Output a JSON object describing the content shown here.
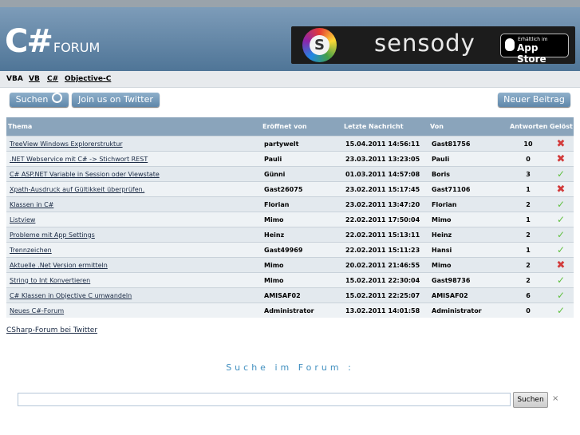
{
  "header": {
    "logo_big": "C#",
    "logo_small": "FORUM",
    "banner": {
      "brand": "sensody",
      "s_letter": "S",
      "appstore_small": "Erhältlich im",
      "appstore_big": "App Store"
    }
  },
  "languages": [
    "VBA",
    "VB",
    "C#",
    "Objective-C"
  ],
  "toolbar": {
    "search_label": "Suchen",
    "twitter_label": "Join us on Twitter",
    "new_post_label": "Neuer Beitrag"
  },
  "table": {
    "columns": [
      "Thema",
      "Eröffnet von",
      "Letzte Nachricht",
      "Von",
      "Antworten",
      "Gelöst"
    ],
    "rows": [
      {
        "topic": "TreeView Windows Explorerstruktur",
        "opened_by": "partywelt",
        "last": "15.04.2011 14:56:11",
        "by": "Gast81756",
        "replies": "10",
        "solved": false
      },
      {
        "topic": ".NET Webservice mit C# -> Stichwort REST",
        "opened_by": "Pauli",
        "last": "23.03.2011 13:23:05",
        "by": "Pauli",
        "replies": "0",
        "solved": false
      },
      {
        "topic": "C# ASP.NET Variable in Session oder Viewstate",
        "opened_by": "Günni",
        "last": "01.03.2011 14:57:08",
        "by": "Boris",
        "replies": "3",
        "solved": true
      },
      {
        "topic": "Xpath-Ausdruck auf Gültikkeit überprüfen.",
        "opened_by": "Gast26075",
        "last": "23.02.2011 15:17:45",
        "by": "Gast71106",
        "replies": "1",
        "solved": false
      },
      {
        "topic": "Klassen in C#",
        "opened_by": "Florian",
        "last": "23.02.2011 13:47:20",
        "by": "Florian",
        "replies": "2",
        "solved": true
      },
      {
        "topic": "Listview",
        "opened_by": "Mimo",
        "last": "22.02.2011 17:50:04",
        "by": "Mimo",
        "replies": "1",
        "solved": true
      },
      {
        "topic": "Probleme mit App Settings",
        "opened_by": "Heinz",
        "last": "22.02.2011 15:13:11",
        "by": "Heinz",
        "replies": "2",
        "solved": true
      },
      {
        "topic": "Trennzeichen",
        "opened_by": "Gast49969",
        "last": "22.02.2011 15:11:23",
        "by": "Hansi",
        "replies": "1",
        "solved": true
      },
      {
        "topic": "Aktuelle .Net Version ermitteln",
        "opened_by": "Mimo",
        "last": "20.02.2011 21:46:55",
        "by": "Mimo",
        "replies": "2",
        "solved": false
      },
      {
        "topic": "String to Int Konvertieren",
        "opened_by": "Mimo",
        "last": "15.02.2011 22:30:04",
        "by": "Gast98736",
        "replies": "2",
        "solved": true
      },
      {
        "topic": "C# Klassen in Objective C umwandeln",
        "opened_by": "AMISAF02",
        "last": "15.02.2011 22:25:07",
        "by": "AMISAF02",
        "replies": "6",
        "solved": true
      },
      {
        "topic": "Neues C#-Forum",
        "opened_by": "Administrator",
        "last": "13.02.2011 14:01:58",
        "by": "Administrator",
        "replies": "0",
        "solved": true
      }
    ],
    "solved_icon": "check-icon",
    "unsolved_icon": "cross-icon"
  },
  "twitter_link": "CSharp-Forum bei Twitter",
  "search": {
    "title": "Suche im Forum :",
    "input_value": "",
    "button_label": "Suchen",
    "close_glyph": "×"
  },
  "colors": {
    "header": "#5f84a5",
    "table_header": "#8aa4bb",
    "solved": "#5fbf3f",
    "unsolved": "#d23b3b",
    "search_title": "#3f8ebf"
  }
}
